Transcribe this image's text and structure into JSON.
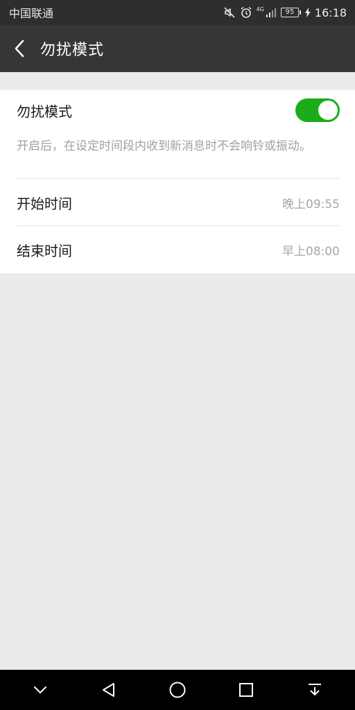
{
  "status_bar": {
    "carrier": "中国联通",
    "network_label": "4G",
    "battery": "95",
    "time": "16:18"
  },
  "app_bar": {
    "title": "勿扰模式",
    "back_icon": "chevron-left-icon"
  },
  "settings": {
    "dnd": {
      "label": "勿扰模式",
      "enabled": true,
      "description": "开启后，在设定时间段内收到新消息时不会响铃或振动。"
    },
    "start": {
      "label": "开始时间",
      "value": "晚上09:55"
    },
    "end": {
      "label": "结束时间",
      "value": "早上08:00"
    }
  },
  "nav_bar": {
    "icons": [
      "chevron-down-icon",
      "back-triangle-icon",
      "home-circle-icon",
      "recents-square-icon",
      "notification-pull-icon"
    ]
  },
  "colors": {
    "accent_green": "#1aad19",
    "app_bar": "#363636",
    "status_bar": "#2e2e2e",
    "background": "#ebebeb"
  }
}
